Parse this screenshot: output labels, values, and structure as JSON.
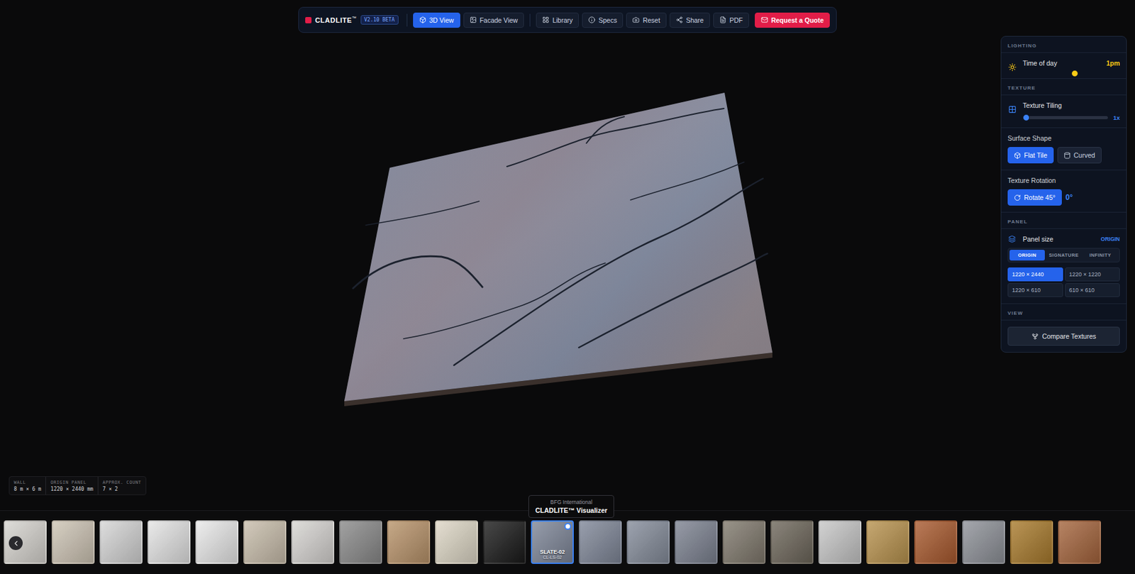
{
  "toolbar": {
    "logo": "CLADLITE",
    "mark": "™",
    "version": "V2.10 BETA",
    "view_tabs": [
      {
        "label": "3D View",
        "selected": true
      },
      {
        "label": "Facade View",
        "selected": false
      }
    ],
    "actions": [
      "Library",
      "Specs",
      "Reset",
      "Share",
      "PDF"
    ],
    "quote": "Request a Quote"
  },
  "controls": {
    "lighting": {
      "header": "LIGHTING",
      "label": "Time of day",
      "value": "1pm",
      "level": 0.54
    },
    "texture": {
      "header": "TEXTURE",
      "tiling": {
        "label": "Texture Tiling",
        "value": "1x",
        "level": 0
      },
      "surface": {
        "label": "Surface Shape",
        "options": [
          {
            "label": "Flat Tile",
            "selected": true
          },
          {
            "label": "Curved",
            "selected": false
          }
        ]
      },
      "rotation": {
        "label": "Texture Rotation",
        "button": "Rotate 45°",
        "value": "0°"
      }
    },
    "panel": {
      "header": "PANEL",
      "label": "Panel size",
      "value": "ORIGIN",
      "series": [
        {
          "label": "ORIGIN",
          "selected": true
        },
        {
          "label": "SIGNATURE",
          "selected": false
        },
        {
          "label": "INFINITY",
          "selected": false
        }
      ],
      "sizes": [
        {
          "label": "1220 × 2440",
          "selected": true
        },
        {
          "label": "1220 × 1220",
          "selected": false
        },
        {
          "label": "1220 × 610",
          "selected": false
        },
        {
          "label": "610 × 610",
          "selected": false
        }
      ]
    },
    "view": {
      "header": "VIEW",
      "button": "Compare Textures"
    }
  },
  "info": [
    {
      "label": "WALL",
      "value": "8 m × 6 m"
    },
    {
      "label": "ORIGIN PANEL",
      "value": "1220 × 2440 mm"
    },
    {
      "label": "APPROX. COUNT",
      "value": "7 × 2"
    }
  ],
  "tooltip": {
    "brand": "BFG International",
    "title": "CLADLITE™ Visualizer"
  },
  "thumbnails": [
    {
      "selected": false,
      "color": "#d6d4cf"
    },
    {
      "selected": false,
      "color": "#cdc4b4"
    },
    {
      "selected": false,
      "color": "#d4d4d4"
    },
    {
      "selected": false,
      "color": "#e3e3e3"
    },
    {
      "selected": false,
      "color": "#e8e8e8"
    },
    {
      "selected": false,
      "color": "#c8bdab"
    },
    {
      "selected": false,
      "color": "#d6d4d1"
    },
    {
      "selected": false,
      "color": "#8a8a8a"
    },
    {
      "selected": false,
      "color": "#b8936a"
    },
    {
      "selected": false,
      "color": "#ddd6c5"
    },
    {
      "selected": false,
      "color": "#1a1a1a"
    },
    {
      "selected": true,
      "color": "#7d8597",
      "name": "SLATE-02",
      "code": "CL-LS-02"
    },
    {
      "selected": false,
      "color": "#7f8798"
    },
    {
      "selected": false,
      "color": "#848c9a"
    },
    {
      "selected": false,
      "color": "#7c8290"
    },
    {
      "selected": false,
      "color": "#7f786c"
    },
    {
      "selected": false,
      "color": "#6d665a"
    },
    {
      "selected": false,
      "color": "#c6c6c6"
    },
    {
      "selected": false,
      "color": "#b8924e"
    },
    {
      "selected": false,
      "color": "#a8592e"
    },
    {
      "selected": false,
      "color": "#8e9198"
    },
    {
      "selected": false,
      "color": "#a87a2c"
    },
    {
      "selected": false,
      "color": "#a4643c"
    }
  ]
}
